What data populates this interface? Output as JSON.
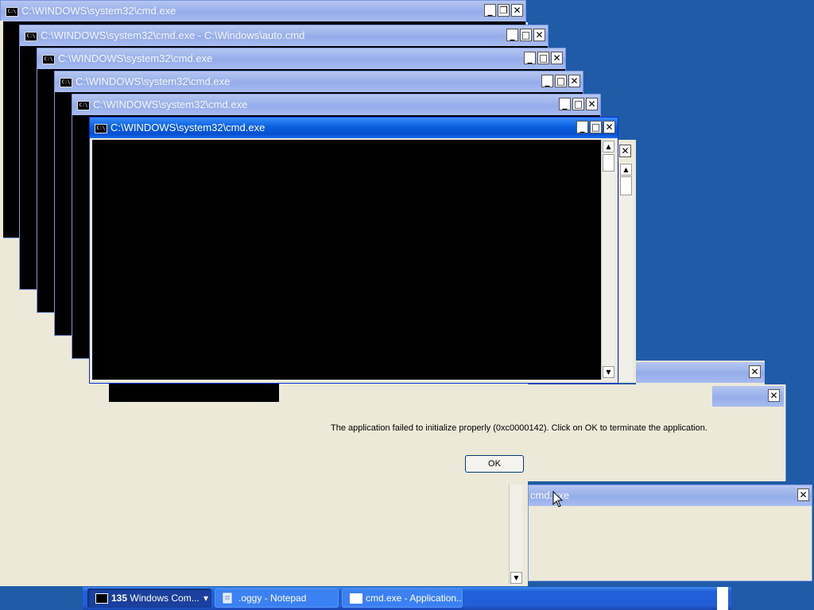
{
  "windows": {
    "w1": {
      "title": "C:\\WINDOWS\\system32\\cmd.exe"
    },
    "w2": {
      "title": "C:\\WINDOWS\\system32\\cmd.exe - C:\\Windows\\auto.cmd"
    },
    "w3": {
      "title": "C:\\WINDOWS\\system32\\cmd.exe"
    },
    "w4": {
      "title": "C:\\WINDOWS\\system32\\cmd.exe"
    },
    "w5": {
      "title": "C:\\WINDOWS\\system32\\cmd.exe"
    },
    "w6": {
      "title": "C:\\WINDOWS\\system32\\cmd.exe"
    }
  },
  "icons": {
    "console": "C:\\",
    "minimize": "_",
    "maximize": "□",
    "restore": "❐",
    "close": "✕",
    "up": "▲",
    "down": "▼",
    "dropdown": "▾"
  },
  "dialog": {
    "message": "The application failed to initialize properly (0xc0000142). Click on OK to terminate the application.",
    "ok_label": "OK"
  },
  "small_dialog": {
    "title": "cmd.exe"
  },
  "taskbar": {
    "group_count": "135",
    "group_label": "Windows Com...",
    "notepad_label": ".oggy - Notepad",
    "cmd_error_label": "cmd.exe - Application..."
  },
  "colors": {
    "desktop": "#1f5ba6",
    "titlebar_active": "#0a5fe0",
    "titlebar_inactive": "#94acea",
    "dialog_bg": "#ece9d8"
  }
}
